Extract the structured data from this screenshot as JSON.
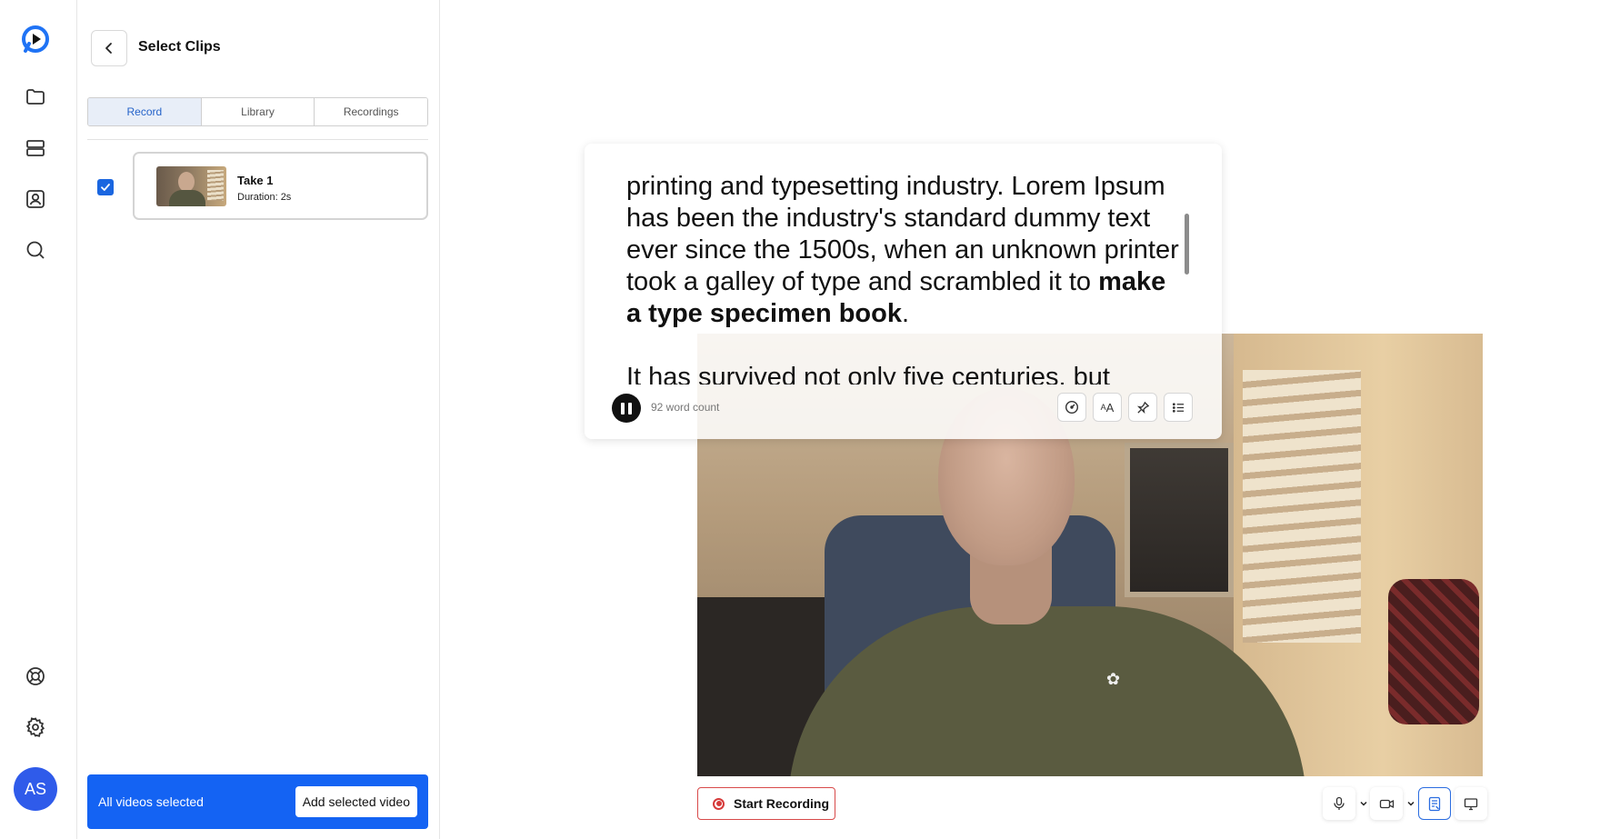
{
  "app": {
    "avatar_initials": "AS"
  },
  "rail": {
    "items": [
      "folder-icon",
      "server-icon",
      "contact-icon",
      "search-icon"
    ],
    "bottom_items": [
      "help-icon",
      "settings-icon"
    ]
  },
  "panel": {
    "title": "Select Clips",
    "tabs": [
      {
        "label": "Record",
        "active": true
      },
      {
        "label": "Library",
        "active": false
      },
      {
        "label": "Recordings",
        "active": false
      }
    ],
    "clips": [
      {
        "name": "Take 1",
        "duration": "Duration: 2s",
        "selected": true
      }
    ],
    "selection_status": "All videos selected",
    "add_button": "Add selected video"
  },
  "prompter": {
    "lines": [
      "printing and typesetting industry. Lorem Ipsum has been the industry's standard dummy text ever since the 1500s, when an unknown printer took a galley of type and scrambled it to ",
      "make a type specimen book",
      ".",
      "It has survived not only five centuries, but"
    ],
    "word_count": "92 word count"
  },
  "controls": {
    "start_recording": "Start Recording"
  },
  "colors": {
    "accent": "#1463f3",
    "record_red": "#d63a3a",
    "tab_active_bg": "#e8eef8"
  }
}
